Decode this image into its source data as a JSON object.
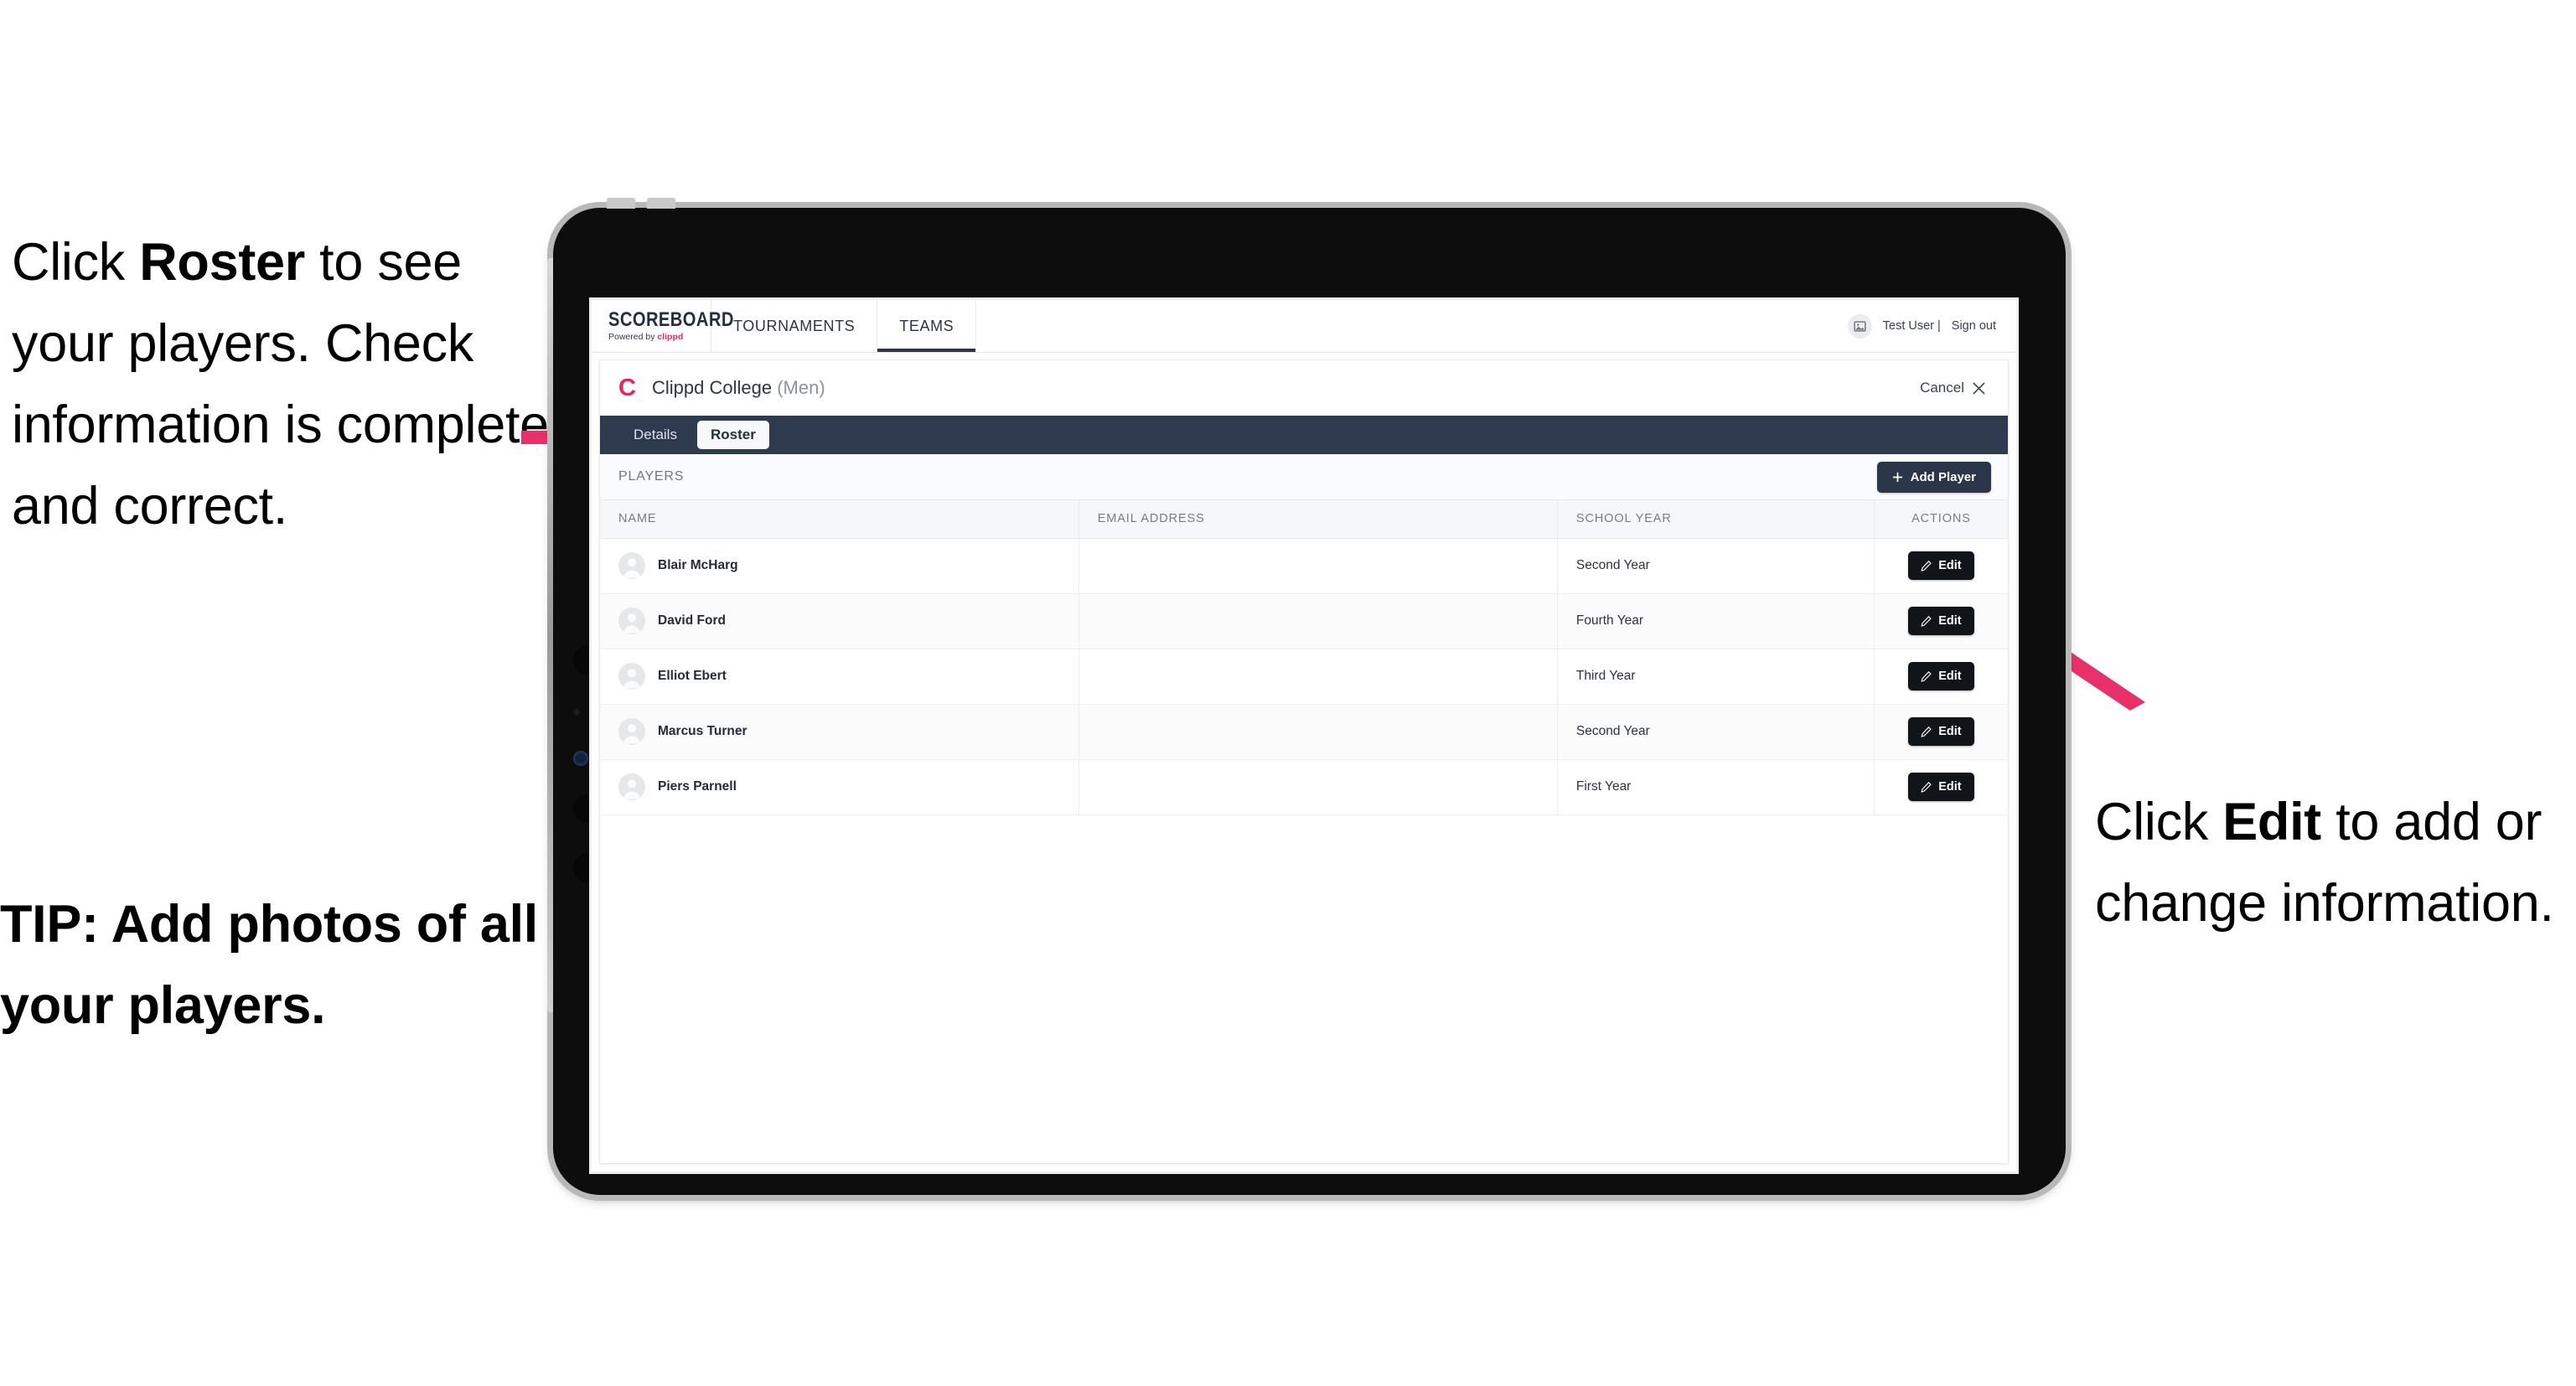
{
  "annotations": {
    "left": "Click **Roster** to see your players. Check information is complete and correct.",
    "left_parts": [
      "Click ",
      "Roster",
      " to see your players. Check information is complete and correct."
    ],
    "right_parts": [
      "Click ",
      "Edit",
      " to add or change information."
    ],
    "tip": "TIP: Add photos of all your players.",
    "arrow_color": "#e8316a"
  },
  "app": {
    "logo": {
      "main": "SCOREBOARD",
      "sub_prefix": "Powered by ",
      "sub_brand": "clippd"
    },
    "nav": [
      {
        "label": "TOURNAMENTS",
        "active": false
      },
      {
        "label": "TEAMS",
        "active": true
      }
    ],
    "user": {
      "name": "Test User |",
      "signout": "Sign out",
      "avatar_icon": "image-placeholder-icon"
    }
  },
  "card": {
    "team_logo_letter": "C",
    "team_name": "Clippd College",
    "team_gender": "(Men)",
    "cancel_label": "Cancel",
    "cancel_icon": "close-x-icon",
    "tabs": [
      {
        "label": "Details",
        "active": false
      },
      {
        "label": "Roster",
        "active": true
      }
    ],
    "section_label": "PLAYERS",
    "add_player_label": "Add Player",
    "add_player_icon": "plus-icon"
  },
  "table": {
    "columns": [
      "NAME",
      "EMAIL ADDRESS",
      "SCHOOL YEAR",
      "ACTIONS"
    ],
    "edit_label": "Edit",
    "edit_icon": "pencil-icon",
    "rows": [
      {
        "name": "Blair McHarg",
        "email": "",
        "school_year": "Second Year"
      },
      {
        "name": "David Ford",
        "email": "",
        "school_year": "Fourth Year"
      },
      {
        "name": "Elliot Ebert",
        "email": "",
        "school_year": "Third Year"
      },
      {
        "name": "Marcus Turner",
        "email": "",
        "school_year": "Second Year"
      },
      {
        "name": "Piers Parnell",
        "email": "",
        "school_year": "First Year"
      }
    ]
  },
  "colors": {
    "brand_pink": "#ef2b5b",
    "nav_dark": "#2e3a4d",
    "button_dark": "#2b3648",
    "edit_dark": "#111418",
    "arrow_pink": "#e8316a"
  }
}
